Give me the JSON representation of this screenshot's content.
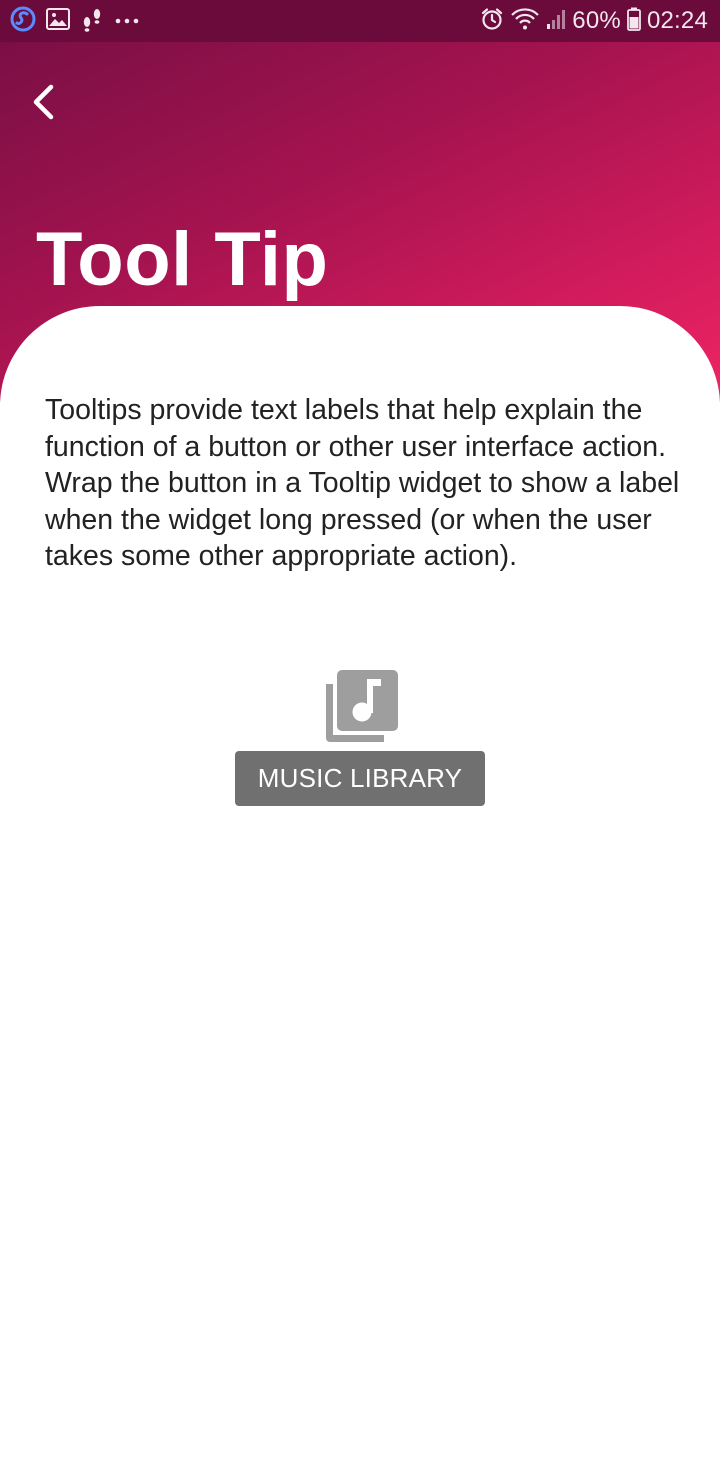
{
  "status_bar": {
    "battery_percent": "60%",
    "time": "02:24",
    "left_icons": [
      "s-app-icon",
      "image-icon",
      "footsteps-icon",
      "more-dots-icon"
    ],
    "right_icons": [
      "alarm-icon",
      "wifi-icon",
      "signal-icon",
      "battery-icon"
    ]
  },
  "header": {
    "title": "Tool Tip",
    "back_icon": "chevron-left-icon",
    "gradient_colors": [
      "#7a0f45",
      "#ee2463"
    ]
  },
  "content": {
    "description": "Tooltips provide text labels that help explain the function of a button or other user interface action. Wrap the button in a Tooltip widget to show a label when the widget long pressed (or when the user takes some other appropriate action).",
    "icon_button": {
      "icon": "library-music-icon",
      "color": "#9e9e9e"
    },
    "tooltip": {
      "label": "MUSIC LIBRARY",
      "background": "#707070"
    }
  }
}
